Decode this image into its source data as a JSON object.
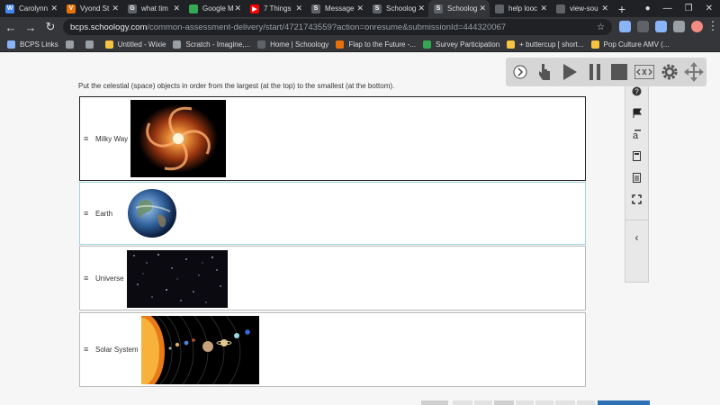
{
  "browser": {
    "tabs": [
      {
        "title": "Carolynn",
        "icon_color": "#4285f4",
        "icon_text": "W"
      },
      {
        "title": "Vyond St",
        "icon_color": "#e8710a",
        "icon_text": "V"
      },
      {
        "title": "what tim",
        "icon_color": "#5f6368",
        "icon_text": "G"
      },
      {
        "title": "Google M",
        "icon_color": "#34a853",
        "icon_text": ""
      },
      {
        "title": "7 Things",
        "icon_color": "#ff0000",
        "icon_text": "▶"
      },
      {
        "title": "Message",
        "icon_color": "#5f6368",
        "icon_text": "S"
      },
      {
        "title": "Schoolog",
        "icon_color": "#5f6368",
        "icon_text": "S"
      },
      {
        "title": "Schoolog",
        "icon_color": "#5f6368",
        "icon_text": "S",
        "active": true
      },
      {
        "title": "help looc",
        "icon_color": "#5f6368",
        "icon_text": ""
      },
      {
        "title": "view-sou",
        "icon_color": "#5f6368",
        "icon_text": ""
      }
    ],
    "url_host": "bcps.schoology.com",
    "url_path": "/common-assessment-delivery/start/4721743559?action=onresume&submissionId=444320067",
    "bookmarks": [
      {
        "label": "BCPS Links",
        "color": "#8ab4f8"
      },
      {
        "label": "",
        "color": "#9aa0a6"
      },
      {
        "label": "",
        "color": "#9aa0a6"
      },
      {
        "label": "Untitled - Wixie",
        "color": "#f6c342"
      },
      {
        "label": "Scratch - Imagine,...",
        "color": "#9aa0a6"
      },
      {
        "label": "Home | Schoology",
        "color": "#5f6368"
      },
      {
        "label": "Flap to the Future -...",
        "color": "#e8710a"
      },
      {
        "label": "Survey Participation",
        "color": "#34a853"
      },
      {
        "label": "+ buttercup [ short...",
        "color": "#f6c342"
      },
      {
        "label": "Pop Culture AMV (...",
        "color": "#f6c342"
      }
    ]
  },
  "question": {
    "prompt": "Put the celestial (space) objects in order from the largest (at the top) to the smallest (at the bottom).",
    "items": [
      {
        "label": "Milky Way",
        "image": "galaxy-image"
      },
      {
        "label": "Earth",
        "image": "earth-image"
      },
      {
        "label": "Universe",
        "image": "universe-image"
      },
      {
        "label": "Solar System",
        "image": "solar-system-image"
      }
    ]
  },
  "sidebar_tools": [
    "help-icon",
    "flag-icon",
    "text-size-icon",
    "calculator-icon",
    "reference-icon",
    "fullscreen-icon",
    "collapse-icon"
  ],
  "player_tools": [
    "expand-icon",
    "point-icon",
    "play-icon",
    "pause-icon",
    "stop-icon",
    "code-icon",
    "settings-icon",
    "move-icon"
  ]
}
